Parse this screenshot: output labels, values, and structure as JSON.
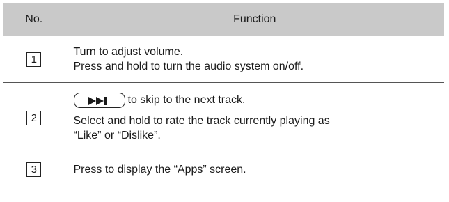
{
  "table": {
    "headers": {
      "no": "No.",
      "function": "Function"
    },
    "rows": [
      {
        "no": "1",
        "lines": [
          "Turn to adjust volume.",
          "Press and hold to turn the audio system on/off."
        ]
      },
      {
        "no": "2",
        "button_icon": "next-track-icon",
        "lines": [
          "to skip to the next track.",
          "Select and hold to rate the track currently playing as",
          "“Like” or “Dislike”."
        ]
      },
      {
        "no": "3",
        "lines": [
          "Press to display the “Apps” screen."
        ]
      }
    ]
  }
}
